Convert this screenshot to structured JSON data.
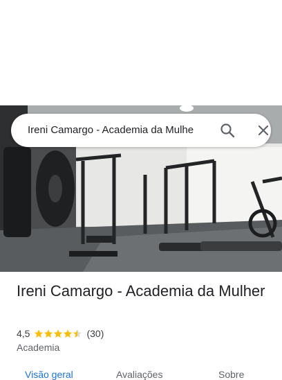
{
  "search": {
    "query": "Ireni Camargo - Academia da Mulhe"
  },
  "place": {
    "name": "Ireni Camargo - Academia da Mulher",
    "rating": "4,5",
    "stars": 4.5,
    "review_count": "(30)",
    "category": "Academia"
  },
  "tabs": [
    {
      "label": "Visão geral"
    },
    {
      "label": "Avaliações"
    },
    {
      "label": "Sobre"
    }
  ],
  "colors": {
    "accent": "#1a73e8",
    "star": "#fbbc04"
  },
  "icons": {
    "search": "search-icon",
    "close": "close-icon"
  }
}
